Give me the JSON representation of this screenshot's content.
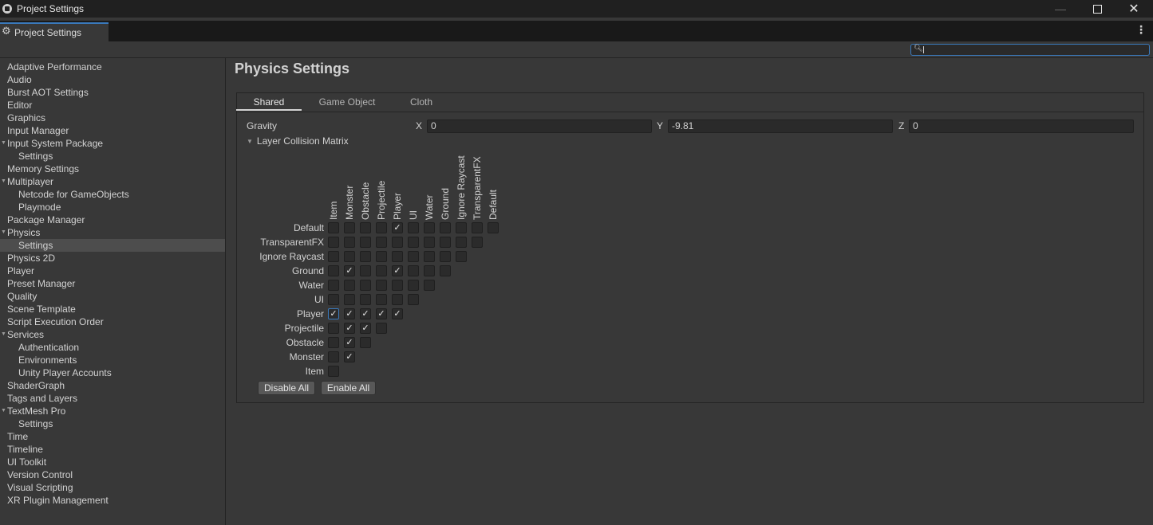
{
  "window": {
    "title": "Project Settings"
  },
  "tab": {
    "label": "Project Settings"
  },
  "search": {
    "value": "",
    "placeholder": ""
  },
  "sidebar": {
    "items": [
      {
        "label": "Adaptive Performance",
        "indent": 0,
        "fold": false,
        "selected": false
      },
      {
        "label": "Audio",
        "indent": 0,
        "fold": false,
        "selected": false
      },
      {
        "label": "Burst AOT Settings",
        "indent": 0,
        "fold": false,
        "selected": false
      },
      {
        "label": "Editor",
        "indent": 0,
        "fold": false,
        "selected": false
      },
      {
        "label": "Graphics",
        "indent": 0,
        "fold": false,
        "selected": false
      },
      {
        "label": "Input Manager",
        "indent": 0,
        "fold": false,
        "selected": false
      },
      {
        "label": "Input System Package",
        "indent": 0,
        "fold": true,
        "selected": false
      },
      {
        "label": "Settings",
        "indent": 1,
        "fold": false,
        "selected": false
      },
      {
        "label": "Memory Settings",
        "indent": 0,
        "fold": false,
        "selected": false
      },
      {
        "label": "Multiplayer",
        "indent": 0,
        "fold": true,
        "selected": false
      },
      {
        "label": "Netcode for GameObjects",
        "indent": 1,
        "fold": false,
        "selected": false
      },
      {
        "label": "Playmode",
        "indent": 1,
        "fold": false,
        "selected": false
      },
      {
        "label": "Package Manager",
        "indent": 0,
        "fold": false,
        "selected": false
      },
      {
        "label": "Physics",
        "indent": 0,
        "fold": true,
        "selected": false
      },
      {
        "label": "Settings",
        "indent": 1,
        "fold": false,
        "selected": true
      },
      {
        "label": "Physics 2D",
        "indent": 0,
        "fold": false,
        "selected": false
      },
      {
        "label": "Player",
        "indent": 0,
        "fold": false,
        "selected": false
      },
      {
        "label": "Preset Manager",
        "indent": 0,
        "fold": false,
        "selected": false
      },
      {
        "label": "Quality",
        "indent": 0,
        "fold": false,
        "selected": false
      },
      {
        "label": "Scene Template",
        "indent": 0,
        "fold": false,
        "selected": false
      },
      {
        "label": "Script Execution Order",
        "indent": 0,
        "fold": false,
        "selected": false
      },
      {
        "label": "Services",
        "indent": 0,
        "fold": true,
        "selected": false
      },
      {
        "label": "Authentication",
        "indent": 1,
        "fold": false,
        "selected": false
      },
      {
        "label": "Environments",
        "indent": 1,
        "fold": false,
        "selected": false
      },
      {
        "label": "Unity Player Accounts",
        "indent": 1,
        "fold": false,
        "selected": false
      },
      {
        "label": "ShaderGraph",
        "indent": 0,
        "fold": false,
        "selected": false
      },
      {
        "label": "Tags and Layers",
        "indent": 0,
        "fold": false,
        "selected": false
      },
      {
        "label": "TextMesh Pro",
        "indent": 0,
        "fold": true,
        "selected": false
      },
      {
        "label": "Settings",
        "indent": 1,
        "fold": false,
        "selected": false
      },
      {
        "label": "Time",
        "indent": 0,
        "fold": false,
        "selected": false
      },
      {
        "label": "Timeline",
        "indent": 0,
        "fold": false,
        "selected": false
      },
      {
        "label": "UI Toolkit",
        "indent": 0,
        "fold": false,
        "selected": false
      },
      {
        "label": "Version Control",
        "indent": 0,
        "fold": false,
        "selected": false
      },
      {
        "label": "Visual Scripting",
        "indent": 0,
        "fold": false,
        "selected": false
      },
      {
        "label": "XR Plugin Management",
        "indent": 0,
        "fold": false,
        "selected": false
      }
    ]
  },
  "main": {
    "title": "Physics Settings",
    "tabs": [
      {
        "label": "Shared",
        "active": true
      },
      {
        "label": "Game Object",
        "active": false
      },
      {
        "label": "Cloth",
        "active": false
      }
    ],
    "gravity": {
      "label": "Gravity",
      "x_label": "X",
      "x": "0",
      "y_label": "Y",
      "y": "-9.81",
      "z_label": "Z",
      "z": "0"
    },
    "layer_matrix": {
      "label": "Layer Collision Matrix",
      "columns": [
        "Item",
        "Monster",
        "Obstacle",
        "Projectile",
        "Player",
        "UI",
        "Water",
        "Ground",
        "Ignore Raycast",
        "TransparentFX",
        "Default"
      ],
      "rows": [
        {
          "label": "Default",
          "checks": [
            false,
            false,
            false,
            false,
            true,
            false,
            false,
            false,
            false,
            false,
            false
          ]
        },
        {
          "label": "TransparentFX",
          "checks": [
            false,
            false,
            false,
            false,
            false,
            false,
            false,
            false,
            false,
            false
          ]
        },
        {
          "label": "Ignore Raycast",
          "checks": [
            false,
            false,
            false,
            false,
            false,
            false,
            false,
            false,
            false
          ]
        },
        {
          "label": "Ground",
          "checks": [
            false,
            true,
            false,
            false,
            true,
            false,
            false,
            false
          ]
        },
        {
          "label": "Water",
          "checks": [
            false,
            false,
            false,
            false,
            false,
            false,
            false
          ]
        },
        {
          "label": "UI",
          "checks": [
            false,
            false,
            false,
            false,
            false,
            false
          ]
        },
        {
          "label": "Player",
          "checks": [
            true,
            true,
            true,
            true,
            true
          ]
        },
        {
          "label": "Projectile",
          "checks": [
            false,
            true,
            true,
            false
          ]
        },
        {
          "label": "Obstacle",
          "checks": [
            false,
            true,
            false
          ]
        },
        {
          "label": "Monster",
          "checks": [
            false,
            true
          ]
        },
        {
          "label": "Item",
          "checks": [
            false
          ]
        }
      ]
    },
    "buttons": {
      "disable_all": "Disable All",
      "enable_all": "Enable All"
    }
  }
}
